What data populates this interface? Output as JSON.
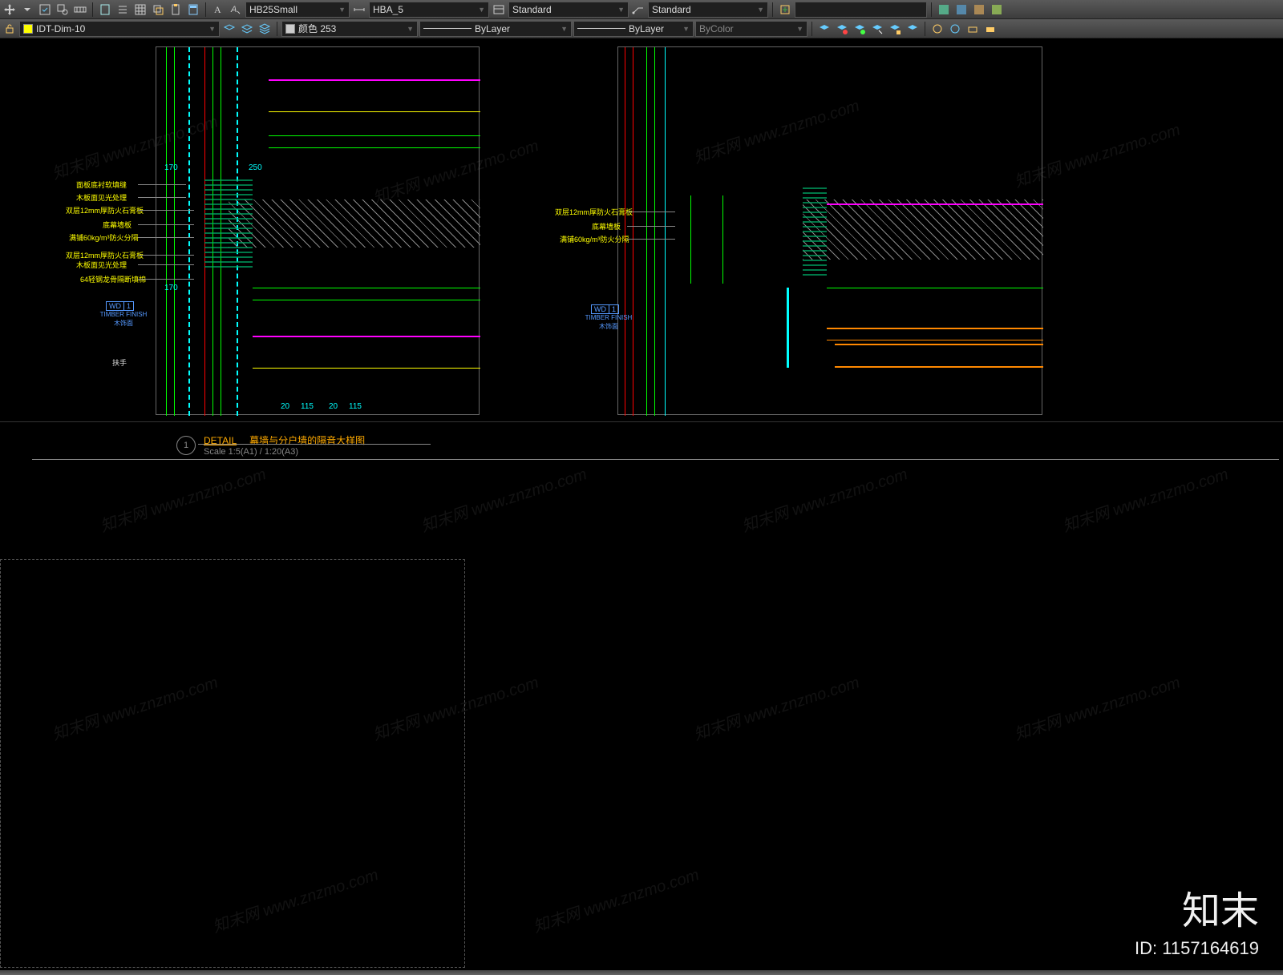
{
  "toolbar1": {
    "text_style": "HB25Small",
    "dim_style": "HBA_5",
    "table_style": "Standard",
    "mleader_style": "Standard"
  },
  "toolbar2": {
    "layer": "IDT-Dim-10",
    "color": "颜色 253",
    "linetype": "ByLayer",
    "lineweight": "ByLayer",
    "plotstyle": "ByColor"
  },
  "drawing": {
    "detail_number": "1",
    "detail_label": "DETAIL",
    "detail_title": "幕墙与分户墙的隔音大样图",
    "scale": "Scale 1:5(A1) / 1:20(A3)",
    "dims": {
      "d170a": "170",
      "d170b": "170",
      "d250": "250",
      "d20a": "20",
      "d115a": "115",
      "d20b": "20",
      "d115b": "115"
    },
    "tag": {
      "wd": "WD",
      "num": "1",
      "finish": "TIMBER FINISH",
      "finish_cn": "木饰面"
    },
    "anno_left": {
      "a1": "面板底衬软填缝",
      "a2": "木板面见光处理",
      "a3": "双层12mm厚防火石膏板",
      "a4": "底幕墙板",
      "a5": "满铺60kg/m³防火分隔",
      "a6": "双层12mm厚防火石膏板",
      "a7": "木板面见光处理",
      "a8": "64轻钢龙骨隔断填棉",
      "a9": "扶手"
    },
    "anno_right": {
      "b1": "双层12mm厚防火石膏板",
      "b2": "底幕墙板",
      "b3": "满铺60kg/m³防火分隔"
    }
  },
  "brand": {
    "name": "知末",
    "id": "ID: 1157164619"
  },
  "watermark": "知末网 www.znzmo.com"
}
